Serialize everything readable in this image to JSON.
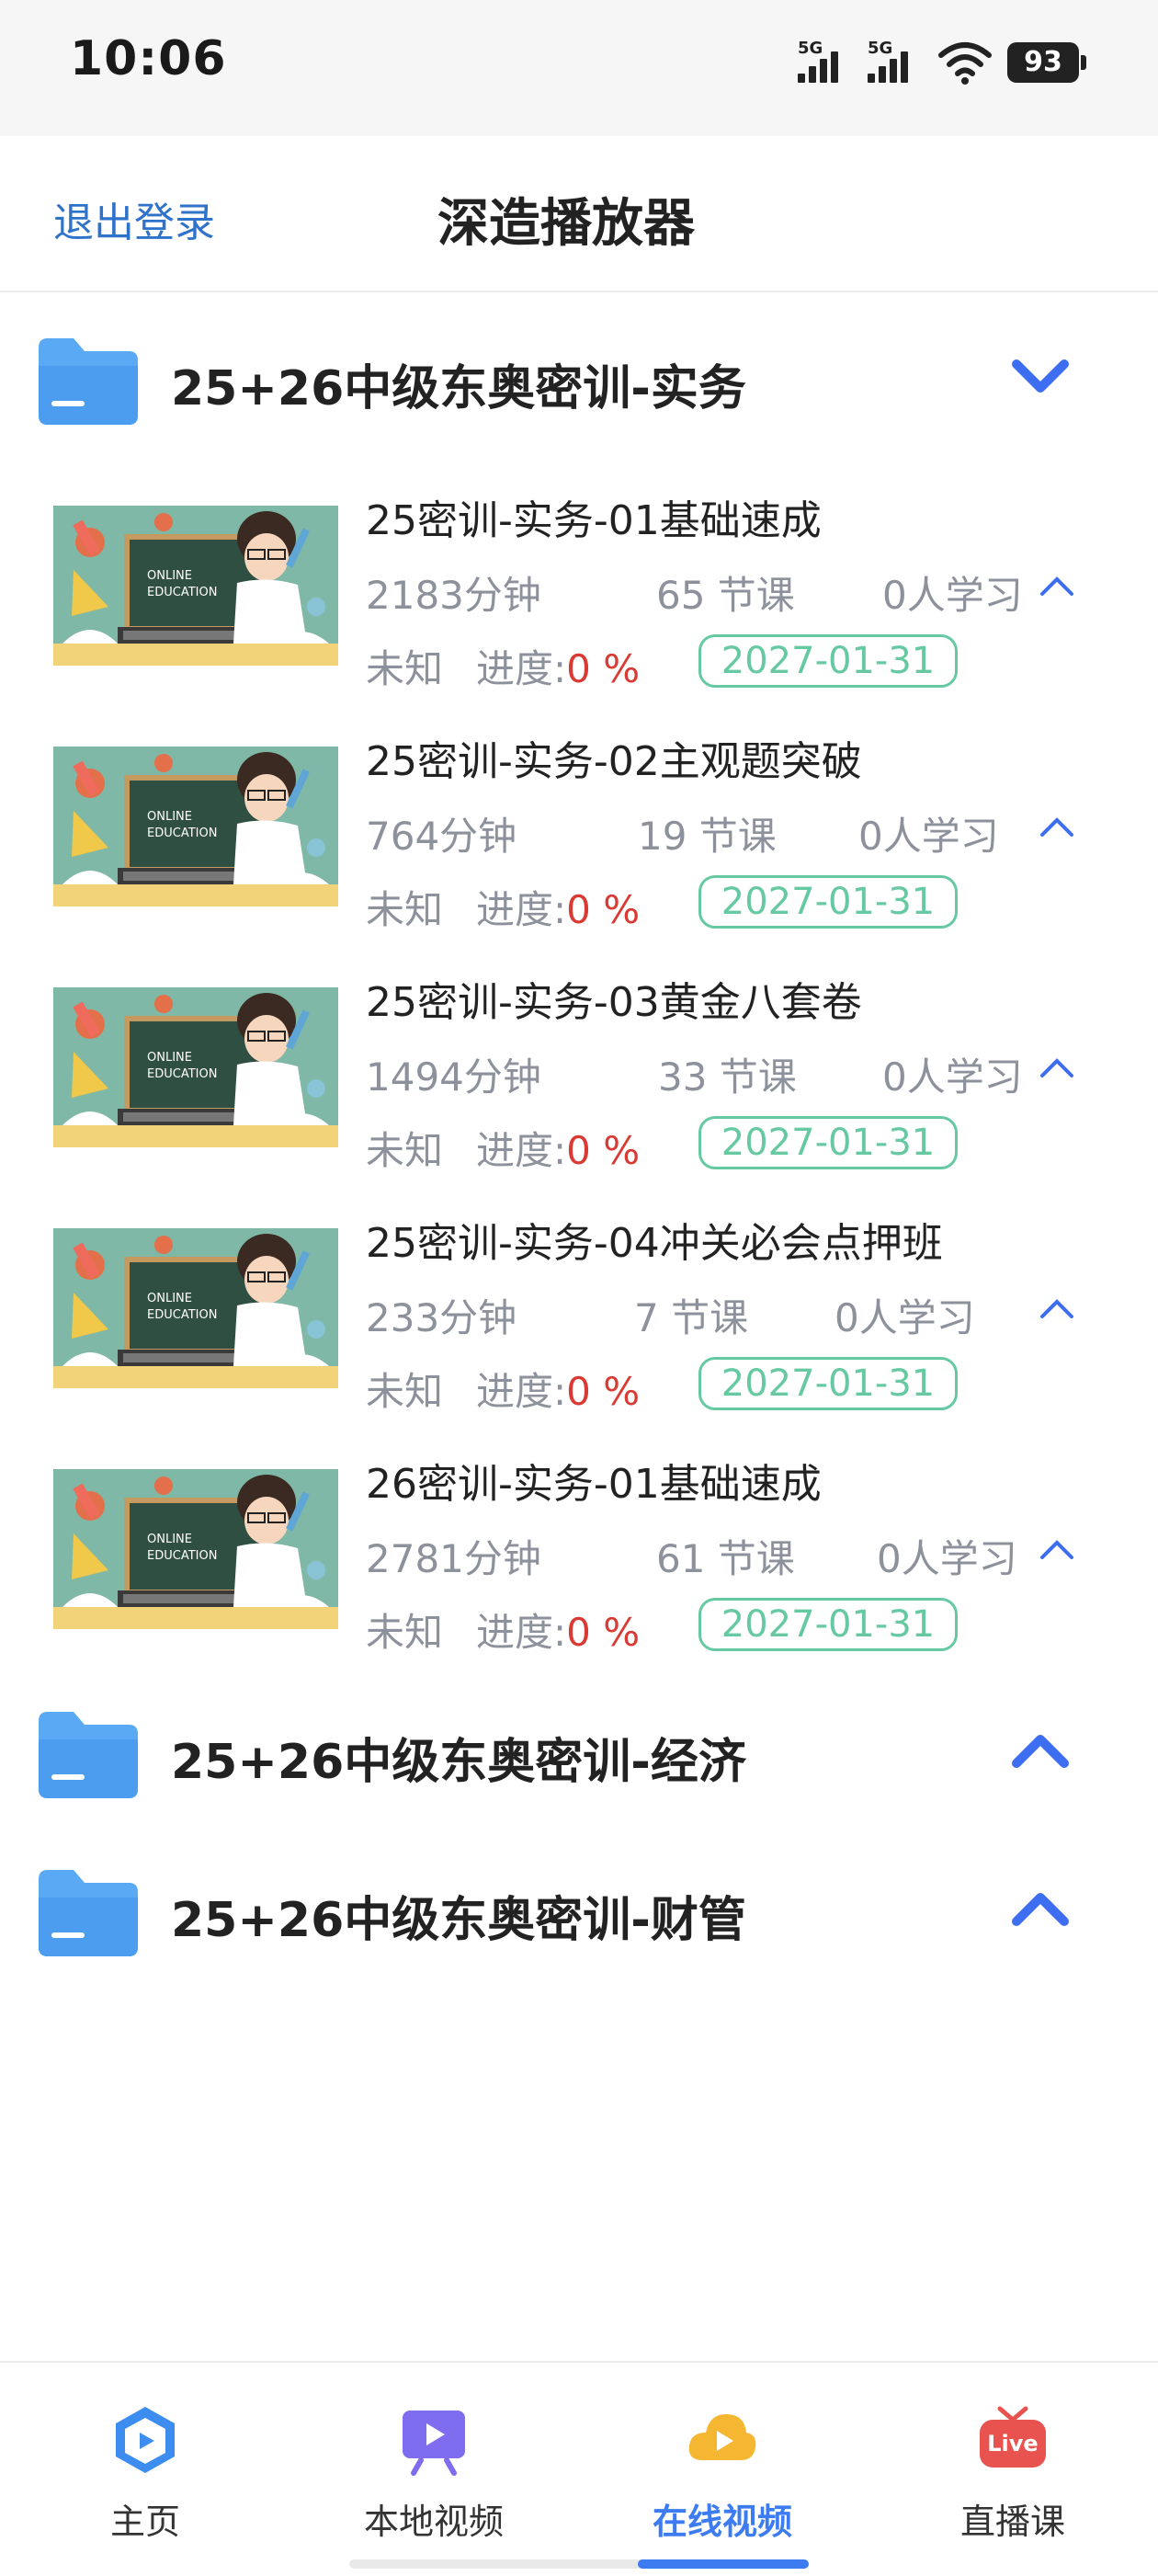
{
  "status_bar": {
    "time": "10:06",
    "signal1_tag": "5G",
    "signal2_tag": "5G",
    "battery": "93"
  },
  "header": {
    "logout_label": "退出登录",
    "title": "深造播放器"
  },
  "groups": [
    {
      "title": "25+26中级东奥密训-实务",
      "expanded": true,
      "courses": [
        {
          "title": "25密训-实务-01基础速成",
          "minutes": "2183分钟",
          "lessons": "65 节课",
          "students": "0人学习",
          "status": "未知",
          "progress_label": "进度:",
          "progress_value": "0 %",
          "expiry": "2027-01-31"
        },
        {
          "title": "25密训-实务-02主观题突破",
          "minutes": "764分钟",
          "lessons": "19 节课",
          "students": "0人学习",
          "status": "未知",
          "progress_label": "进度:",
          "progress_value": "0 %",
          "expiry": "2027-01-31"
        },
        {
          "title": "25密训-实务-03黄金八套卷",
          "minutes": "1494分钟",
          "lessons": "33 节课",
          "students": "0人学习",
          "status": "未知",
          "progress_label": "进度:",
          "progress_value": "0 %",
          "expiry": "2027-01-31"
        },
        {
          "title": "25密训-实务-04冲关必会点押班",
          "minutes": "233分钟",
          "lessons": "7 节课",
          "students": "0人学习",
          "status": "未知",
          "progress_label": "进度:",
          "progress_value": "0 %",
          "expiry": "2027-01-31"
        },
        {
          "title": "26密训-实务-01基础速成",
          "minutes": "2781分钟",
          "lessons": "61 节课",
          "students": "0人学习",
          "status": "未知",
          "progress_label": "进度:",
          "progress_value": "0 %",
          "expiry": "2027-01-31"
        }
      ]
    },
    {
      "title": "25+26中级东奥密训-经济",
      "expanded": false
    },
    {
      "title": "25+26中级东奥密训-财管",
      "expanded": false
    }
  ],
  "thumbnail": {
    "board_text_line1": "ONLINE",
    "board_text_line2": "EDUCATION"
  },
  "tabbar": {
    "tabs": [
      {
        "label": "主页",
        "icon": "home-shield-icon",
        "active": false
      },
      {
        "label": "本地视频",
        "icon": "local-video-icon",
        "active": false
      },
      {
        "label": "在线视频",
        "icon": "cloud-play-icon",
        "active": true
      },
      {
        "label": "直播课",
        "icon": "live-tv-icon",
        "active": false
      }
    ],
    "live_badge": "Live"
  },
  "colors": {
    "accent": "#3d7cf0",
    "link": "#2f72c9",
    "progress_red": "#d93a34",
    "date_green": "#66c9a2",
    "folder_blue": "#5aa9f5"
  }
}
